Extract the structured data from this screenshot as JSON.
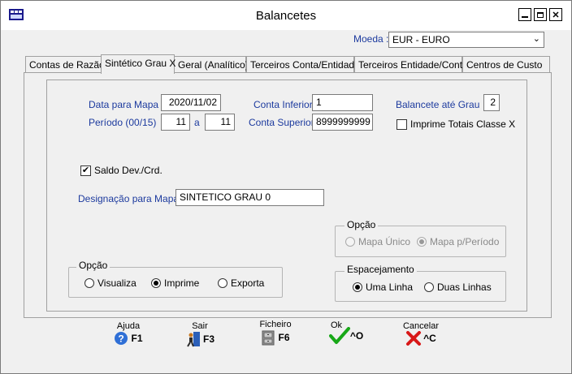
{
  "window": {
    "title": "Balancetes",
    "minimize": "▁",
    "maximize": "□",
    "close": "✕"
  },
  "moeda": {
    "label": "Moeda :",
    "value": "EUR - EURO"
  },
  "tabs": [
    {
      "label": "Contas de Razão"
    },
    {
      "label": "Sintético Grau X"
    },
    {
      "label": "Geral (Analítico)"
    },
    {
      "label": "Terceiros Conta/Entidade"
    },
    {
      "label": "Terceiros Entidade/Conta"
    },
    {
      "label": "Centros de Custo"
    }
  ],
  "form": {
    "data_mapa_label": "Data para Mapa",
    "data_mapa_value": "2020/11/02",
    "periodo_label": "Período (00/15)",
    "periodo_from": "11",
    "periodo_sep": "a",
    "periodo_to": "11",
    "conta_inferior_label": "Conta Inferior",
    "conta_inferior_value": "1",
    "conta_superior_label": "Conta Superior",
    "conta_superior_value": "8999999999",
    "balancete_label": "Balancete até Grau",
    "balancete_value": "2",
    "imprime_totais_label": "Imprime Totais Classe X",
    "saldo_label": "Saldo Dev./Crd.",
    "designacao_label": "Designação para Mapa",
    "designacao_value": "SINTETICO GRAU 0"
  },
  "opcao_mapa": {
    "title": "Opção",
    "unico": "Mapa Único",
    "periodo": "Mapa p/Período"
  },
  "opcao_saida": {
    "title": "Opção",
    "visualiza": "Visualiza",
    "imprime": "Imprime",
    "exporta": "Exporta"
  },
  "espacamento": {
    "title": "Espacejamento",
    "uma": "Uma Linha",
    "duas": "Duas Linhas"
  },
  "toolbar": {
    "ajuda_top": "Ajuda",
    "ajuda_key": "F1",
    "sair_top": "Sair",
    "sair_key": "F3",
    "ficheiro_top": "Ficheiro",
    "ficheiro_key": "F6",
    "ok_top": "Ok",
    "ok_key": "^O",
    "cancelar_top": "Cancelar",
    "cancelar_key": "^C"
  }
}
